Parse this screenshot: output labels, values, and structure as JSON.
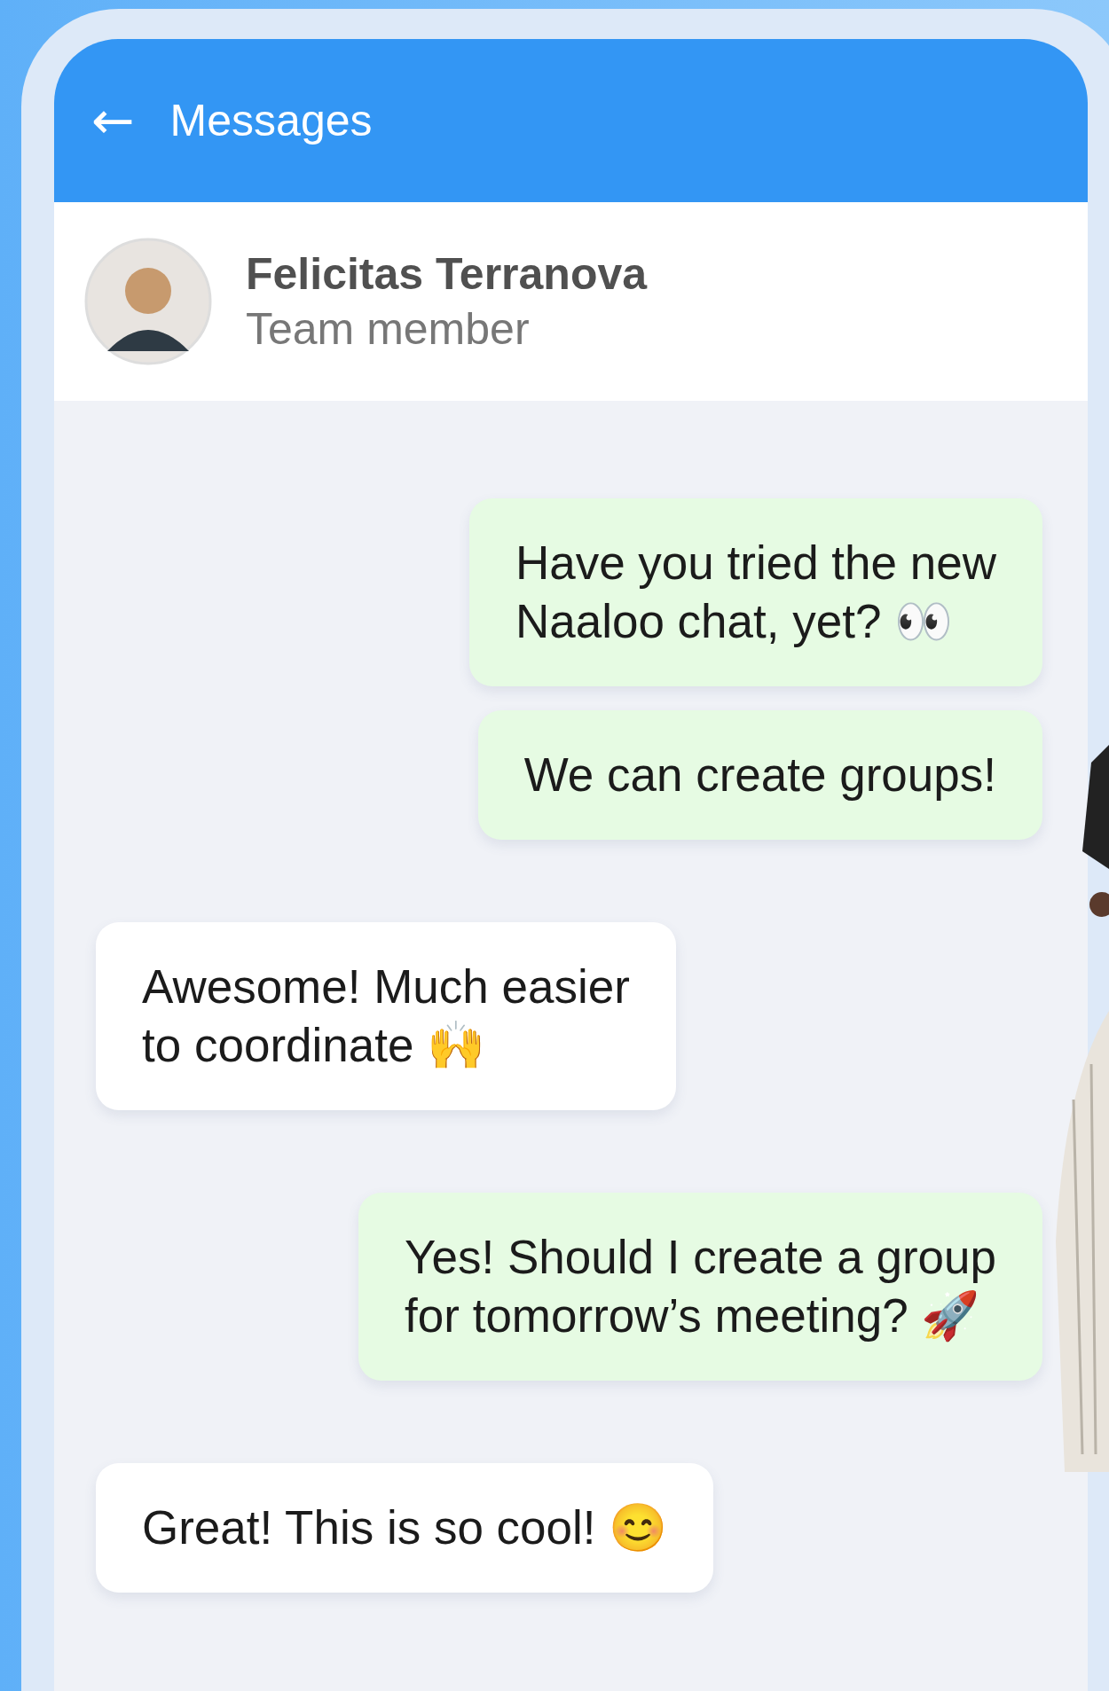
{
  "header": {
    "back": "←",
    "title": "Messages"
  },
  "contact": {
    "name": "Felicitas Terranova",
    "role": "Team member"
  },
  "messages": [
    {
      "kind": "sent",
      "text": "Have you tried the new\nNaaloo chat, yet? 👀"
    },
    {
      "kind": "sent",
      "text": "We can create groups!"
    },
    {
      "kind": "received",
      "text": "Awesome! Much easier\nto coordinate 🙌"
    },
    {
      "kind": "sent",
      "text": "Yes! Should I create a group\nfor tomorrow’s meeting? 🚀"
    },
    {
      "kind": "received",
      "text": "Great! This is so cool! 😊"
    }
  ]
}
